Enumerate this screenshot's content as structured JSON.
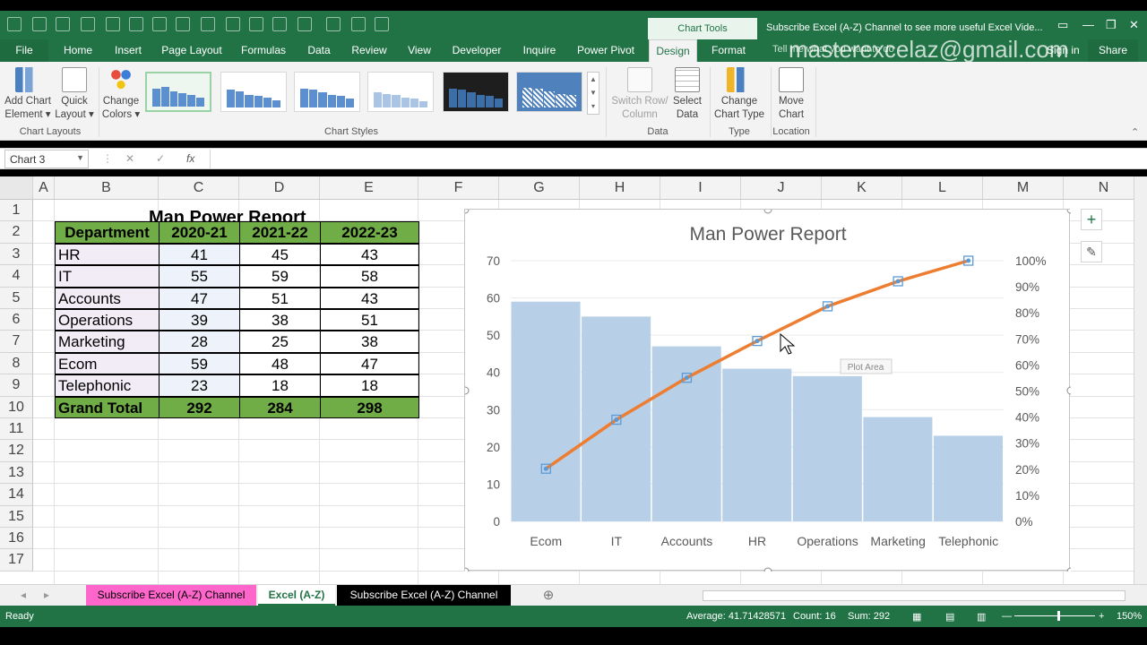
{
  "window": {
    "chart_tools_label": "Chart Tools",
    "title": "Subscribe Excel (A-Z) Channel to see more useful Excel Vide...",
    "watermark": "masterexcelaz@gmail.com",
    "tell_me": "Tell me what you want to do",
    "sign_in": "Sign in",
    "share": "Share"
  },
  "tabs": [
    "File",
    "Home",
    "Insert",
    "Page Layout",
    "Formulas",
    "Data",
    "Review",
    "View",
    "Developer",
    "Inquire",
    "Power Pivot",
    "Design",
    "Format"
  ],
  "ribbon": {
    "add_chart_element": [
      "Add Chart",
      "Element ▾"
    ],
    "quick_layout": [
      "Quick",
      "Layout ▾"
    ],
    "change_colors": [
      "Change",
      "Colors ▾"
    ],
    "switch_row_column": [
      "Switch Row/",
      "Column"
    ],
    "select_data": [
      "Select",
      "Data"
    ],
    "change_chart_type": [
      "Change",
      "Chart Type"
    ],
    "move_chart": [
      "Move",
      "Chart"
    ],
    "groups": {
      "chart_layouts": "Chart Layouts",
      "chart_styles": "Chart Styles",
      "data": "Data",
      "type": "Type",
      "location": "Location"
    }
  },
  "formula_bar": {
    "name_box": "Chart 3",
    "fx": "fx",
    "cancel": "✕",
    "enter": "✓",
    "formula": ""
  },
  "columns": [
    "A",
    "B",
    "C",
    "D",
    "E",
    "F",
    "G",
    "H",
    "I",
    "J",
    "K",
    "L",
    "M",
    "N"
  ],
  "rows": [
    "1",
    "2",
    "3",
    "4",
    "5",
    "6",
    "7",
    "8",
    "9",
    "10",
    "11",
    "12",
    "13",
    "14",
    "15",
    "16",
    "17"
  ],
  "table": {
    "title": "Man Power Report",
    "headers": [
      "Department",
      "2020-21",
      "2021-22",
      "2022-23"
    ],
    "rows": [
      [
        "HR",
        "41",
        "45",
        "43"
      ],
      [
        "IT",
        "55",
        "59",
        "58"
      ],
      [
        "Accounts",
        "47",
        "51",
        "43"
      ],
      [
        "Operations",
        "39",
        "38",
        "51"
      ],
      [
        "Marketing",
        "28",
        "25",
        "38"
      ],
      [
        "Ecom",
        "59",
        "48",
        "47"
      ],
      [
        "Telephonic",
        "23",
        "18",
        "18"
      ]
    ],
    "total": [
      "Grand Total",
      "292",
      "284",
      "298"
    ]
  },
  "chart_data": {
    "type": "bar",
    "title": "Man Power Report",
    "categories": [
      "Ecom",
      "IT",
      "Accounts",
      "HR",
      "Operations",
      "Marketing",
      "Telephonic"
    ],
    "values": [
      59,
      55,
      47,
      41,
      39,
      28,
      23
    ],
    "cumulative_pct": [
      20.2,
      39.0,
      55.1,
      69.2,
      82.5,
      92.1,
      100
    ],
    "ylim": [
      0,
      70
    ],
    "yticks": [
      "0",
      "10",
      "20",
      "30",
      "40",
      "50",
      "60",
      "70"
    ],
    "y2lim": [
      0,
      100
    ],
    "y2ticks": [
      "0%",
      "10%",
      "20%",
      "30%",
      "40%",
      "50%",
      "60%",
      "70%",
      "80%",
      "90%",
      "100%"
    ],
    "bar_color": "#b8cfe8",
    "line_color": "#ed7d31",
    "tooltip": "Plot Area"
  },
  "sheets": [
    {
      "name": "Subscribe Excel (A-Z) Channel",
      "bg": "#ff66cc",
      "fg": "#000000"
    },
    {
      "name": "Excel (A-Z)",
      "bg": "#ffffff",
      "fg": "#217346"
    },
    {
      "name": "Subscribe Excel (A-Z) Channel",
      "bg": "#000000",
      "fg": "#ffffff"
    }
  ],
  "status": {
    "ready": "Ready",
    "average": "Average: 41.71428571",
    "count": "Count: 16",
    "sum": "Sum: 292",
    "zoom": "150%"
  }
}
